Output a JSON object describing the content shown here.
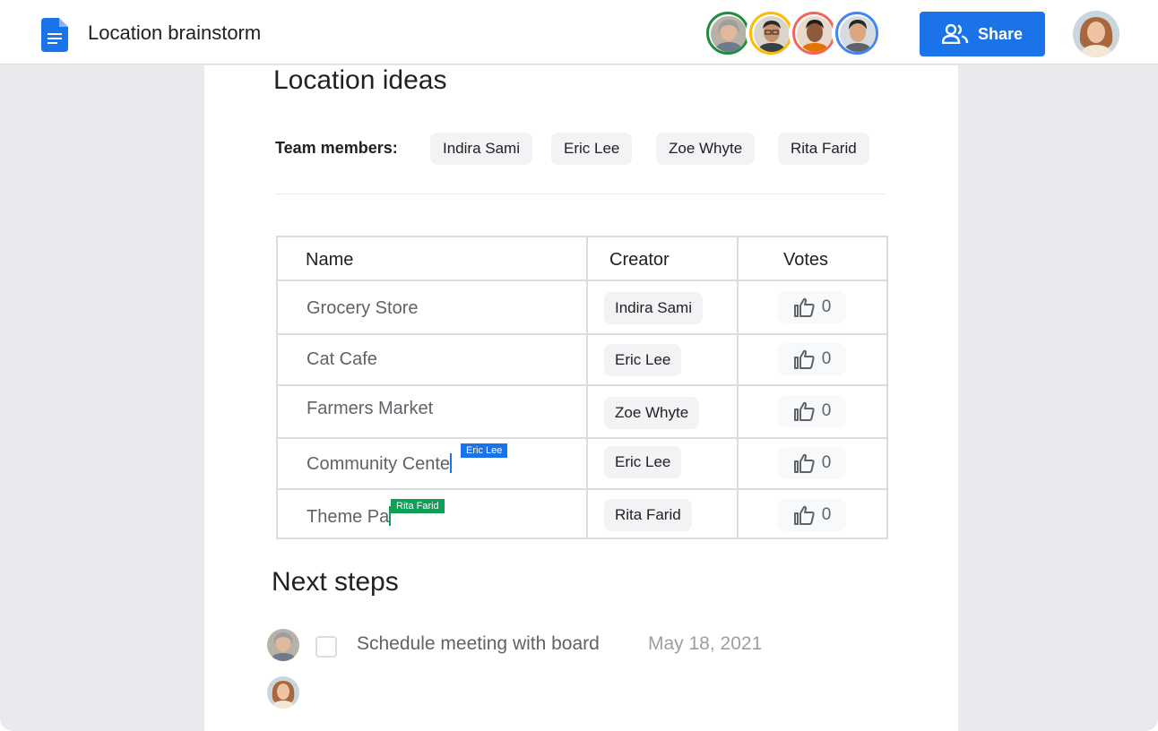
{
  "app": {
    "doc_title": "Location brainstorm",
    "doc_icon": "docs-icon",
    "share_label": "Share",
    "share_icon": "people-icon",
    "accent_color": "#1a73e8",
    "collaborators": [
      {
        "name": "collaborator-1",
        "ring_color": "#1e8e3e"
      },
      {
        "name": "collaborator-2",
        "ring_color": "#fbbc04"
      },
      {
        "name": "collaborator-3",
        "ring_color": "#ee675c"
      },
      {
        "name": "collaborator-4",
        "ring_color": "#4285f4"
      }
    ]
  },
  "doc": {
    "heading": "Location ideas",
    "team_label": "Team members:",
    "team_members": [
      "Indira Sami",
      "Eric Lee",
      "Zoe Whyte",
      "Rita Farid"
    ],
    "table": {
      "headers": {
        "name": "Name",
        "creator": "Creator",
        "votes": "Votes"
      },
      "rows": [
        {
          "name": "Grocery Store",
          "creator": "Indira Sami",
          "votes": "0"
        },
        {
          "name": "Cat Cafe",
          "creator": "Eric Lee",
          "votes": "0"
        },
        {
          "name": "Farmers Market",
          "creator": "Zoe Whyte",
          "votes": "0"
        },
        {
          "name": "Community Cente",
          "creator": "Eric Lee",
          "votes": "0",
          "cursor": "Eric Lee",
          "cursor_color": "#1a73e8"
        },
        {
          "name": "Theme Pa",
          "creator": "Rita Farid",
          "votes": "0",
          "cursor": "Rita Farid",
          "cursor_color": "#0f9d58"
        }
      ]
    },
    "next_steps_heading": "Next steps",
    "tasks": [
      {
        "text": "Schedule meeting with board",
        "date": "May 18, 2021",
        "checked": false
      }
    ]
  }
}
